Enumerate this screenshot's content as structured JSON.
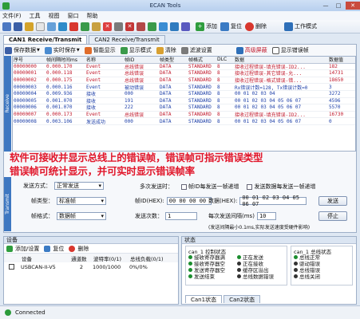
{
  "window": {
    "title": "ECAN Tools"
  },
  "menu": [
    "文件(F)",
    "工具",
    "视图",
    "窗口",
    "帮助"
  ],
  "toolbar": {
    "add_label": "添加",
    "reset_label": "复位",
    "delete_label": "删除",
    "mode_label": "工作模式"
  },
  "tabs": [
    "CAN1 Receive/Transmit",
    "CAN2 Receive/Transmit"
  ],
  "subbar": {
    "save": "保存数据",
    "realtime_save": "实时保存",
    "smart_display": "智能显示",
    "display_mode": "显示模式",
    "clear": "清除",
    "filter": "滤波设置",
    "advanced_filter": "高级屏蔽",
    "show_error": "显示错误帧"
  },
  "side_labels": {
    "receive": "Receive",
    "transmit": "Transmit"
  },
  "grid": {
    "headers": [
      "序号",
      "帧间隔时间ms",
      "名称",
      "帧ID",
      "帧类型",
      "帧格式",
      "DLC",
      "数据",
      "数据值"
    ],
    "rows": [
      [
        "00000000",
        "0.000.170",
        "Event",
        "总线错误",
        "DATA",
        "STANDARD",
        "8",
        "接收过程错误-填充错误-ID2...",
        "182",
        "red"
      ],
      [
        "00000001",
        "0.000.118",
        "Event",
        "总线错误",
        "DATA",
        "STANDARD",
        "8",
        "接收过程错误-其它错误-允...",
        "14731",
        "red"
      ],
      [
        "00000002",
        "0.000.175",
        "Event",
        "总线错误",
        "DATA",
        "STANDARD",
        "8",
        "接收过程错误-格式错误-错...",
        "18650",
        "red"
      ],
      [
        "00000003",
        "0.000.116",
        "Event",
        "被动错误",
        "DATA",
        "STANDARD",
        "8",
        "Rx错误计数=128, Tx错误计数=0",
        "3",
        "blue"
      ],
      [
        "00000004",
        "0.009.936",
        "接收",
        "000",
        "DATA",
        "STANDARD",
        "8",
        "00 01 02 03 04",
        "3272",
        "blue"
      ],
      [
        "00000005",
        "0.001.070",
        "接收",
        "191",
        "DATA",
        "STANDARD",
        "8",
        "00 01 02 03 04 05 06 07",
        "4596",
        "blue"
      ],
      [
        "00000006",
        "0.001.070",
        "接收",
        "222",
        "DATA",
        "STANDARD",
        "8",
        "00 01 02 03 04 05 06 07",
        "5570",
        "blue"
      ],
      [
        "00000007",
        "0.000.173",
        "Event",
        "总线错误",
        "DATA",
        "STANDARD",
        "8",
        "接收过程错误-填充错误-ID2...",
        "16730",
        "red"
      ],
      [
        "00000008",
        "0.003.106",
        "发送成功",
        "000",
        "DATA",
        "STANDARD",
        "8",
        "00 01 02 03 04 05 06 07",
        "0",
        "blue"
      ]
    ]
  },
  "overlay": {
    "line1": "软件可接收并显示总线上的错误帧，错误帧可指示错误类型",
    "line2": "错误帧可统计显示，并可实时显示错误帧率"
  },
  "transmit": {
    "send_mode_label": "发送方式：",
    "send_mode_value": "正常发送",
    "multi_send_label": "多次发送时：",
    "per_send_id_inc": "帧ID每发送一帧递增",
    "per_send_data_inc": "发送数据每发送一帧递增",
    "frame_type_label": "帧类型：",
    "frame_type_value": "标准帧",
    "frame_id_label": "帧ID(HEX):",
    "frame_id_value": "00 00 00 00",
    "data_label": "数据(HEX):",
    "data_value": "00 01 02 03 04 05 06 07",
    "send_button": "发送",
    "frame_format_label": "帧格式：",
    "frame_format_value": "数据帧",
    "send_count_label": "发送次数：",
    "send_count_value": "1",
    "interval_label": "每次发送间隔(ms)",
    "interval_value": "10",
    "stop_button": "停止",
    "note": "(发送间隔最小0.1ms,实际发送速度受硬件影响)"
  },
  "devices": {
    "title": "设备",
    "add_label": "添加/设置",
    "reset_label": "复位",
    "delete_label": "删除",
    "headers": [
      "设备",
      "通道数",
      "波特率(0/1)",
      "总线负载(0/1)"
    ],
    "row": [
      "USBCAN-II-V5",
      "2",
      "1000/1000",
      "0%/0%"
    ]
  },
  "status": {
    "title": "状态",
    "ctrl_title": "can_1 控制状态",
    "bus_title": "can_1 总线状态",
    "ctrl_col1": [
      "接收寄存器满",
      "接收寄存器空",
      "发送寄存器空",
      "发送结束"
    ],
    "ctrl_col2": [
      "正在发送",
      "正在接收",
      "缓存区溢出",
      "总线数据错误"
    ],
    "bus_col": [
      "总线正常",
      "驱动错误",
      "总线错误",
      "总线关闭"
    ],
    "tabs": [
      "Can1状态",
      "Can2状态"
    ]
  },
  "statusbar": {
    "text": "Connected"
  }
}
